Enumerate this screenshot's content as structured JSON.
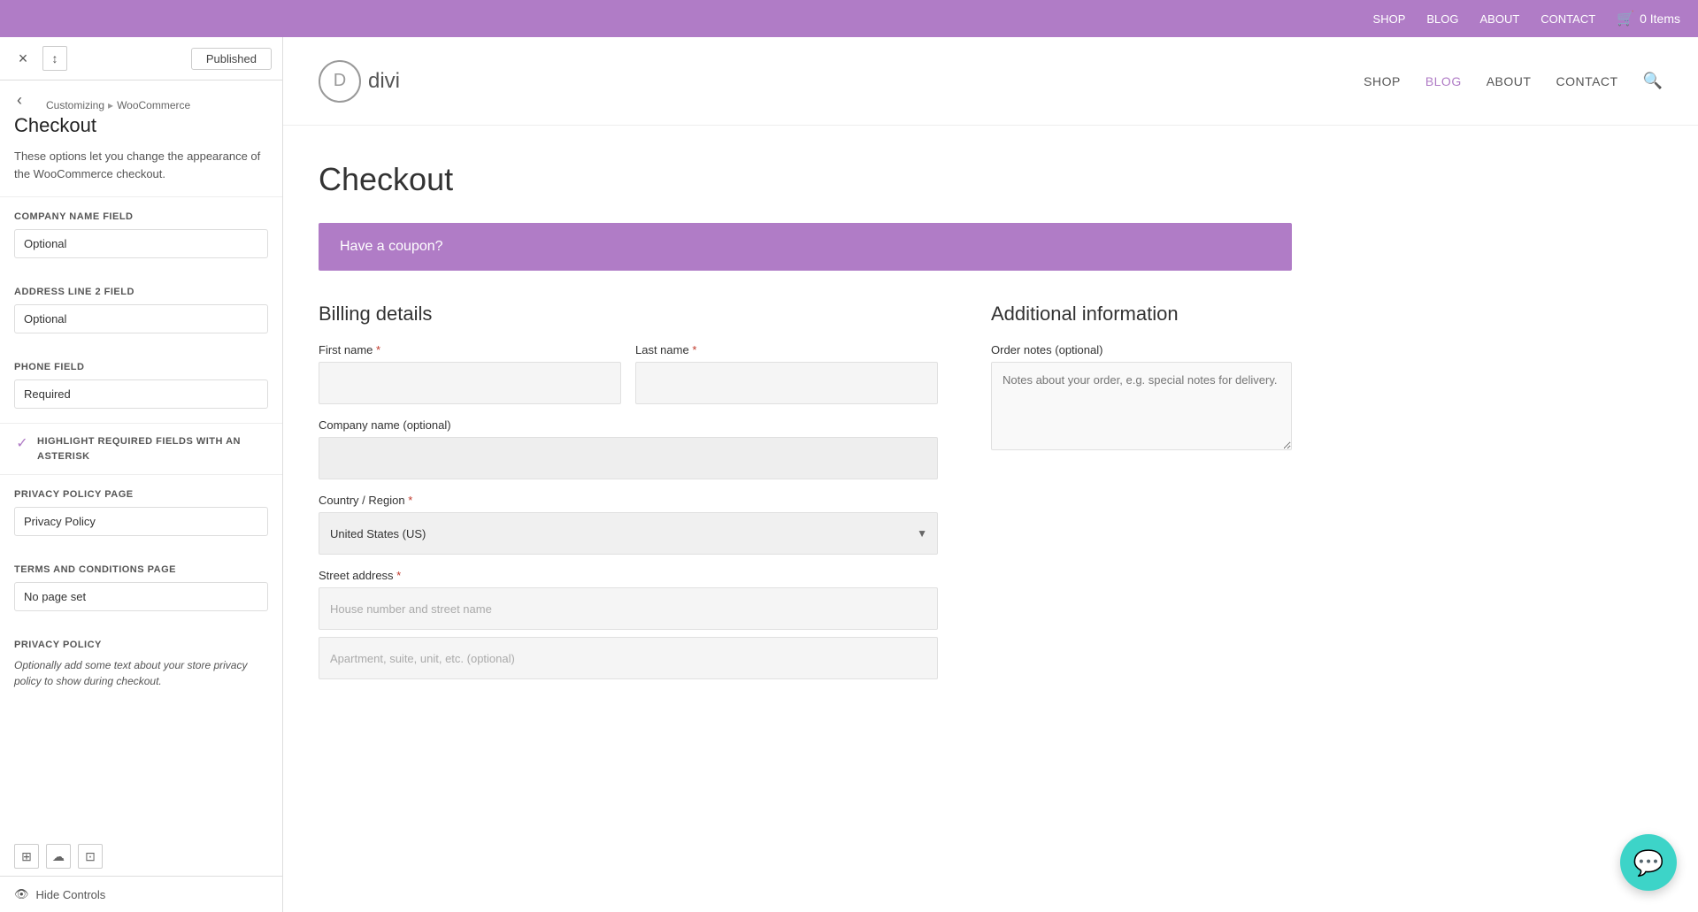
{
  "topbar": {
    "nav_items": [
      "SHOP",
      "BLOG",
      "ABOUT",
      "CONTACT"
    ],
    "cart_label": "0 Items"
  },
  "sidebar": {
    "close_label": "×",
    "sort_label": "↕",
    "published_label": "Published",
    "back_label": "‹",
    "breadcrumb_parent": "Customizing",
    "breadcrumb_separator": "▸",
    "breadcrumb_child": "WooCommerce",
    "title": "Checkout",
    "description": "These options let you change the appearance of the WooCommerce checkout.",
    "company_field_label": "COMPANY NAME FIELD",
    "company_field_value": "Optional",
    "address2_field_label": "ADDRESS LINE 2 FIELD",
    "address2_field_value": "Optional",
    "phone_field_label": "PHONE FIELD",
    "phone_field_value": "Required",
    "checkbox_label": "HIGHLIGHT REQUIRED FIELDS WITH AN ASTERISK",
    "checkbox_checked": true,
    "privacy_policy_label": "PRIVACY POLICY PAGE",
    "privacy_policy_value": "Privacy Policy",
    "terms_label": "TERMS AND CONDITIONS PAGE",
    "terms_value": "No page set",
    "privacy_section_label": "PRIVACY POLICY",
    "privacy_text": "Optionally add some text about your store privacy policy to show during checkout.",
    "hide_controls_label": "Hide Controls",
    "icon1": "⊞",
    "icon2": "☁",
    "icon3": "⊡"
  },
  "preview": {
    "logo_letter": "D",
    "logo_name": "divi",
    "nav_items": [
      {
        "label": "SHOP",
        "active": false
      },
      {
        "label": "BLOG",
        "active": true
      },
      {
        "label": "ABOUT",
        "active": false
      },
      {
        "label": "CONTACT",
        "active": false
      }
    ],
    "checkout_title": "Checkout",
    "coupon_text": "Have a coupon?",
    "billing_title": "Billing details",
    "additional_title": "Additional information",
    "first_name_label": "First name",
    "last_name_label": "Last name",
    "company_label": "Company name (optional)",
    "country_label": "Country / Region",
    "country_value": "United States (US)",
    "street_label": "Street address",
    "street_placeholder": "House number and street name",
    "apt_placeholder": "Apartment, suite, unit, etc. (optional)",
    "order_notes_label": "Order notes (optional)",
    "order_notes_placeholder": "Notes about your order, e.g. special notes for delivery."
  },
  "chat": {
    "icon": "💬"
  }
}
